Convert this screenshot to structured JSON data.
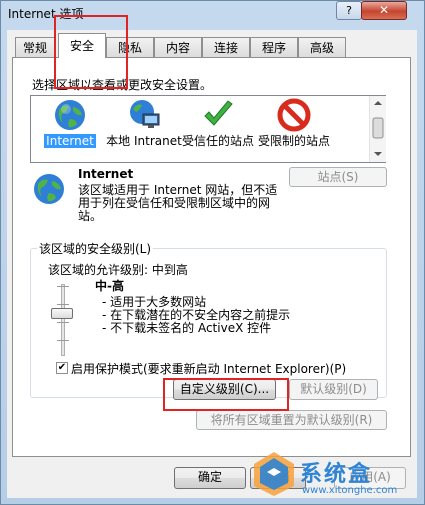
{
  "window": {
    "title": "Internet 选项",
    "help_label": "?",
    "close_label": "✕"
  },
  "tabs": [
    {
      "label": "常规"
    },
    {
      "label": "安全"
    },
    {
      "label": "隐私"
    },
    {
      "label": "内容"
    },
    {
      "label": "连接"
    },
    {
      "label": "程序"
    },
    {
      "label": "高级"
    }
  ],
  "active_tab": "安全",
  "zones": {
    "prompt": "选择区域以查看或更改安全设置。",
    "items": [
      {
        "label": "Internet",
        "icon": "globe-icon"
      },
      {
        "label": "本地 Intranet",
        "icon": "intranet-icon"
      },
      {
        "label": "受信任的站点",
        "icon": "check-icon"
      },
      {
        "label": "受限制的站点",
        "icon": "blocked-icon"
      }
    ]
  },
  "details": {
    "title": "Internet",
    "description": "该区域适用于 Internet 网站，但不适用于列在受信任和受限制区域中的网站。",
    "sites_button": "站点(S)"
  },
  "security_level": {
    "group_label": "该区域的安全级别(L)",
    "allowed": "该区域的允许级别: 中到高",
    "level_name": "中-高",
    "bullets": [
      "- 适用于大多数网站",
      "- 在下载潜在的不安全内容之前提示",
      "- 不下载未签名的 ActiveX 控件"
    ],
    "protected_mode_label": "启用保护模式(要求重新启动 Internet Explorer)(P)",
    "protected_mode_checked": true,
    "check_mark": "✔",
    "custom_button": "自定义级别(C)...",
    "default_button": "默认级别(D)",
    "reset_button": "将所有区域重置为默认级别(R)"
  },
  "footer": {
    "ok": "确定",
    "cancel": "取消",
    "apply": "应用(A)"
  },
  "watermark": {
    "text": "系统盒",
    "url": "www.xitonghe.com"
  },
  "colors": {
    "highlight": "#e02424",
    "selection": "#3399ff",
    "watermark": "#2f84d4"
  }
}
